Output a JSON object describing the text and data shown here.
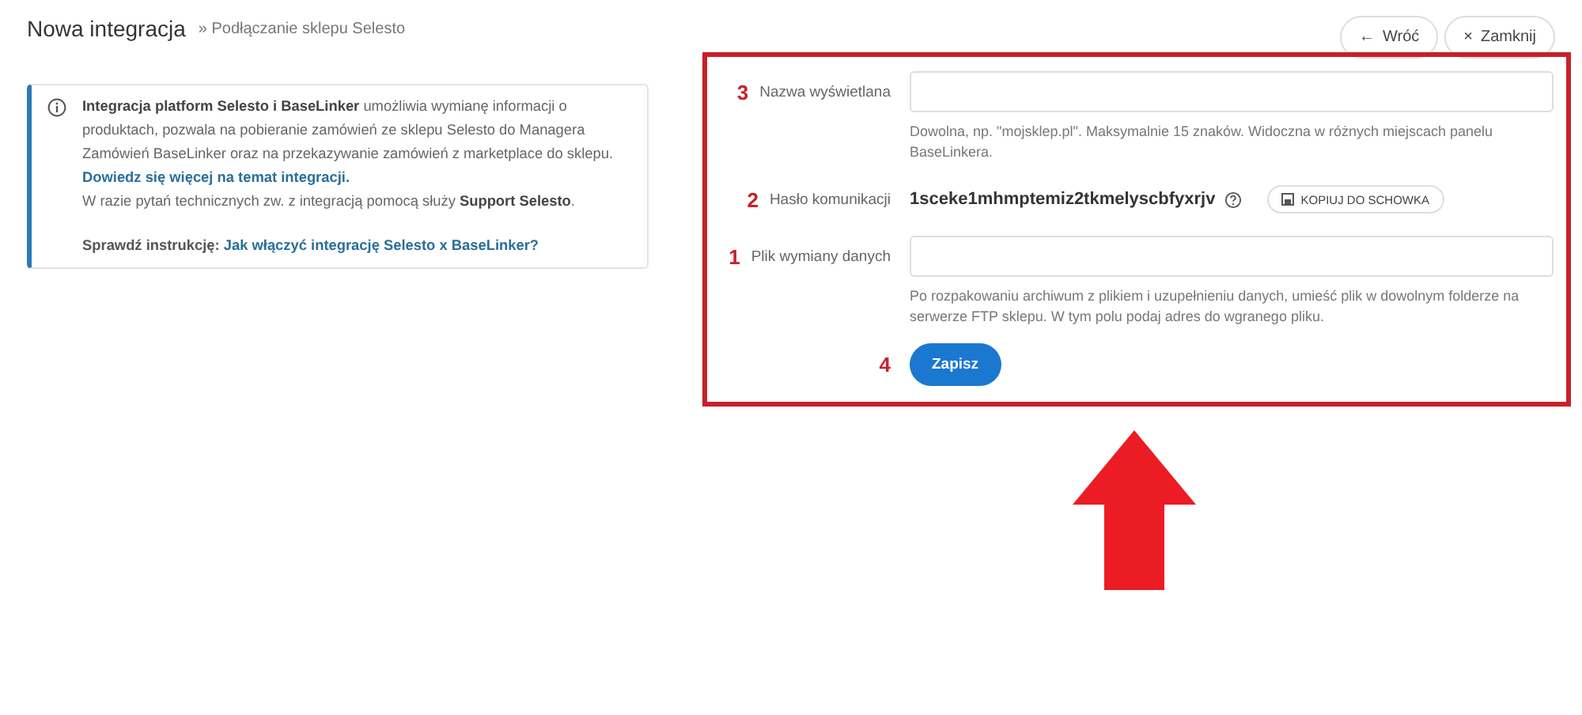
{
  "header": {
    "title": "Nowa integracja",
    "breadcrumb": "» Podłączanie sklepu Selesto",
    "buttons": [
      {
        "icon": "←",
        "label": "Wróć"
      },
      {
        "icon": "×",
        "label": "Zamknij"
      }
    ]
  },
  "info": {
    "paragraph": "**Integracja platform Selesto i BaseLinker** umożliwia wymianę informacji o produktach, pozwala na pobieranie zamówień ze sklepu Selesto do Managera Zamówień BaseLinker oraz na przekazywanie zamówień z marketplace do sklepu.",
    "link": "Dowiedz się więcej na temat integracji.",
    "support": "W razie pytań technicznych zw. z integracją pomocą służy **Support Selesto**.",
    "instruction_label": "Sprawdź instrukcję:",
    "instruction_link": "Jak włączyć integrację Selesto x BaseLinker?"
  },
  "form": {
    "rows": [
      {
        "kind": "input",
        "marker": "3",
        "label": "Nazwa wyświetlana",
        "hint": "Dowolna, np. \"mojsklep.pl\". Maksymalnie 15 znaków. Widoczna w różnych miejscach panelu BaseLinkera."
      },
      {
        "kind": "secret",
        "marker": "2",
        "label": "Hasło komunikacji",
        "value": "1sceke1mhmptemiz2tkmelyscbfyxrjv",
        "copy_button": "KOPIUJ DO SCHOWKA"
      },
      {
        "kind": "input",
        "marker": "1",
        "label": "Plik wymiany danych",
        "hint": "Po rozpakowaniu archiwum z plikiem i uzupełnieniu danych, umieść plik w dowolnym folderze na serwerze FTP sklepu. W tym polu podaj adres do wgranego pliku."
      }
    ],
    "submit": {
      "marker": "4",
      "label": "Zapisz"
    }
  }
}
